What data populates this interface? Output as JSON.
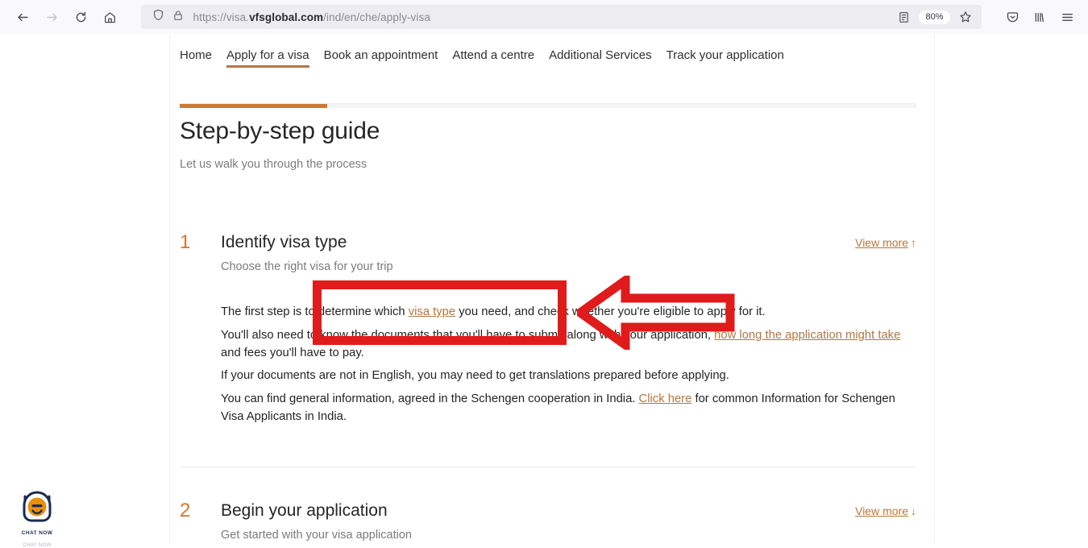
{
  "browser": {
    "back_icon": "back-arrow-icon",
    "forward_icon": "forward-arrow-icon",
    "reload_icon": "reload-icon",
    "home_icon": "home-icon",
    "shield_icon": "shield-icon",
    "lock_icon": "padlock-icon",
    "url_prefix": "https://visa.",
    "url_domain": "vfsglobal.com",
    "url_path": "/ind/en/che/apply-visa",
    "url_full": "https://visa.vfsglobal.com/ind/en/che/apply-visa",
    "reader_icon": "reader-mode-icon",
    "zoom_level": "80%",
    "bookmark_icon": "star-bookmark-icon",
    "pocket_icon": "pocket-icon",
    "library_icon": "library-icon",
    "menu_icon": "hamburger-menu-icon"
  },
  "site": {
    "nav": [
      {
        "label": "Home",
        "active": false
      },
      {
        "label": "Apply for a visa",
        "active": true
      },
      {
        "label": "Book an appointment",
        "active": false
      },
      {
        "label": "Attend a centre",
        "active": false
      },
      {
        "label": "Additional Services",
        "active": false
      },
      {
        "label": "Track your application",
        "active": false
      }
    ],
    "progress_percent": 20,
    "title": "Step-by-step guide",
    "subtitle": "Let us walk you through the process"
  },
  "steps": [
    {
      "number": "1",
      "title": "Identify visa type",
      "subtitle": "Choose the right visa for your trip",
      "view_more_label": "View more",
      "view_more_arrow": "↑",
      "paragraphs": [
        {
          "parts": [
            {
              "type": "text",
              "value": "The first step is to determine which "
            },
            {
              "type": "link",
              "value": "visa type"
            },
            {
              "type": "text",
              "value": " you need, and check whether you're eligible to apply for it."
            }
          ]
        },
        {
          "parts": [
            {
              "type": "text",
              "value": "You'll also need to know the documents that you'll have to submit along with your application, "
            },
            {
              "type": "link",
              "value": "how long the application might take"
            },
            {
              "type": "text",
              "value": " and fees you'll have to pay."
            }
          ]
        },
        {
          "parts": [
            {
              "type": "text",
              "value": "If your documents are not in English, you may need to get translations prepared before applying."
            }
          ]
        },
        {
          "parts": [
            {
              "type": "text",
              "value": "You can find general information, agreed in the Schengen cooperation in India. "
            },
            {
              "type": "link",
              "value": "Click here"
            },
            {
              "type": "text",
              "value": " for common Information for Schengen Visa Applicants in India."
            }
          ]
        }
      ]
    },
    {
      "number": "2",
      "title": "Begin your application",
      "subtitle": "Get started with your visa application",
      "view_more_label": "View more",
      "view_more_arrow": "↓",
      "paragraphs": []
    }
  ],
  "annotations": {
    "color": "#e01b1b",
    "rectangle_name": "red-highlight-rectangle",
    "arrow_name": "red-left-arrow"
  },
  "chat_widget": {
    "label": "CHAT NOW",
    "label_shadow": "CHAT NOW",
    "icon": "chat-bubble-icon"
  }
}
